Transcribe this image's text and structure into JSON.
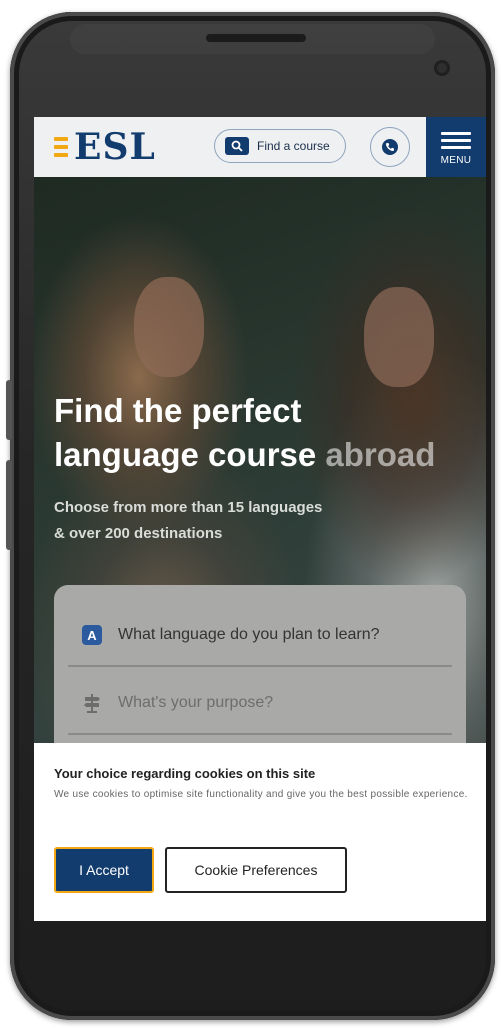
{
  "header": {
    "logo_text": "ESL",
    "find_course_label": "Find a course",
    "menu_label": "MENU",
    "brand_color": "#123b6e",
    "accent_color": "#f3a712"
  },
  "hero": {
    "title_line1": "Find the perfect",
    "title_line2a": "language course ",
    "title_line2b": "abroad",
    "subtitle_line1": "Choose from more than 15 languages",
    "subtitle_line2": "& over 200 destinations"
  },
  "search": {
    "language_icon_letter": "A",
    "language_prompt": "What language do you plan to learn?",
    "purpose_prompt": "What's your purpose?"
  },
  "cookie_banner": {
    "title": "Your choice regarding cookies on this site",
    "text": "We use cookies to optimise site functionality and give you the best possible experience.",
    "accept_label": "I Accept",
    "preferences_label": "Cookie Preferences"
  }
}
